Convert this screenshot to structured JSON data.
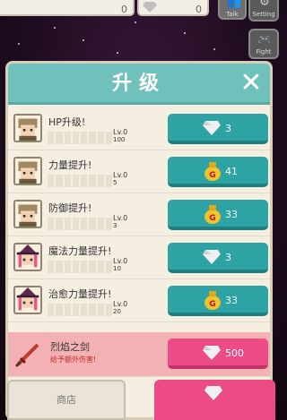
{
  "top_bar": {
    "gold_count": "0",
    "gem_count": "0",
    "side_buttons": [
      {
        "label": "Talk",
        "icon": "people-icon"
      },
      {
        "label": "Setting",
        "icon": "gear-icon"
      },
      {
        "label": "Fight",
        "icon": "controller-icon"
      }
    ]
  },
  "dialog": {
    "title": "升级",
    "close_icon": "close-icon",
    "upgrades": [
      {
        "name": "HP升级!",
        "level": "Lv.0",
        "sub": "100",
        "currency": "gem",
        "cost": "3"
      },
      {
        "name": "力量提升!",
        "level": "Lv.0",
        "sub": "5",
        "currency": "gold",
        "cost": "41"
      },
      {
        "name": "防御提升!",
        "level": "Lv.0",
        "sub": "3",
        "currency": "gold",
        "cost": "33"
      },
      {
        "name": "魔法力量提升!",
        "level": "Lv.0",
        "sub": "10",
        "currency": "gem",
        "cost": "3"
      },
      {
        "name": "治愈力量提升!",
        "level": "Lv.0",
        "sub": "20",
        "currency": "gold",
        "cost": "33"
      }
    ],
    "featured": {
      "name": "烈焰之剑",
      "description": "给予额外伤害!",
      "currency": "gem",
      "cost": "500"
    }
  },
  "bottom": {
    "shop_label": "商店"
  },
  "colors": {
    "header_teal": "#6fc1bc",
    "button_teal": "#2da4a3",
    "button_pink": "#ec4c86",
    "highlight_row": "#f4b1b4"
  }
}
